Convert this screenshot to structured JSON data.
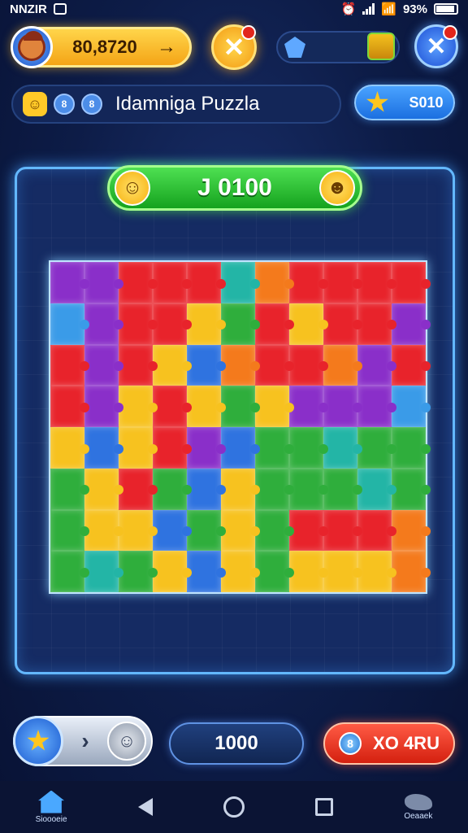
{
  "status_bar": {
    "left_text": "NNZIR",
    "battery_text": "93%"
  },
  "header": {
    "coin_value": "80,8720",
    "coin_arrow": "→",
    "orange_btn_icon": "✕",
    "blue_btn_icon": "✕"
  },
  "title_bar": {
    "title": "Idamniga Puzzla",
    "mini_icon_1": "8",
    "mini_icon_2": "8",
    "smiley": "☺"
  },
  "star_pill": {
    "value": "S010"
  },
  "score": {
    "value": "J 0100",
    "left_face": "☺",
    "right_face": "☻"
  },
  "board": {
    "piece_colors": {
      "R": "#e8232b",
      "O": "#f47a1c",
      "Y": "#f7c21f",
      "G": "#2fae3c",
      "B": "#2f73e0",
      "P": "#8a2fc9",
      "T": "#23b5a6",
      "L": "#3a9be8"
    },
    "rows": [
      "PPRRRTOR R R",
      "LPRRYGRYRRP",
      "RPRYBORROPR",
      "RPYRYGYPPPL",
      "YBYRPBGGTGG",
      "GYRGBYGGGTG",
      "GYYBGYGRRRO",
      "GTGYBYGYYYO"
    ]
  },
  "bottom": {
    "hint_arrow": "›",
    "robot_face": "☺",
    "center_value": "1000",
    "red_value": "XO 4RU",
    "red_coin": "8"
  },
  "nav": {
    "home_label": "Sioooeie",
    "right_label": "Oeaaek"
  }
}
